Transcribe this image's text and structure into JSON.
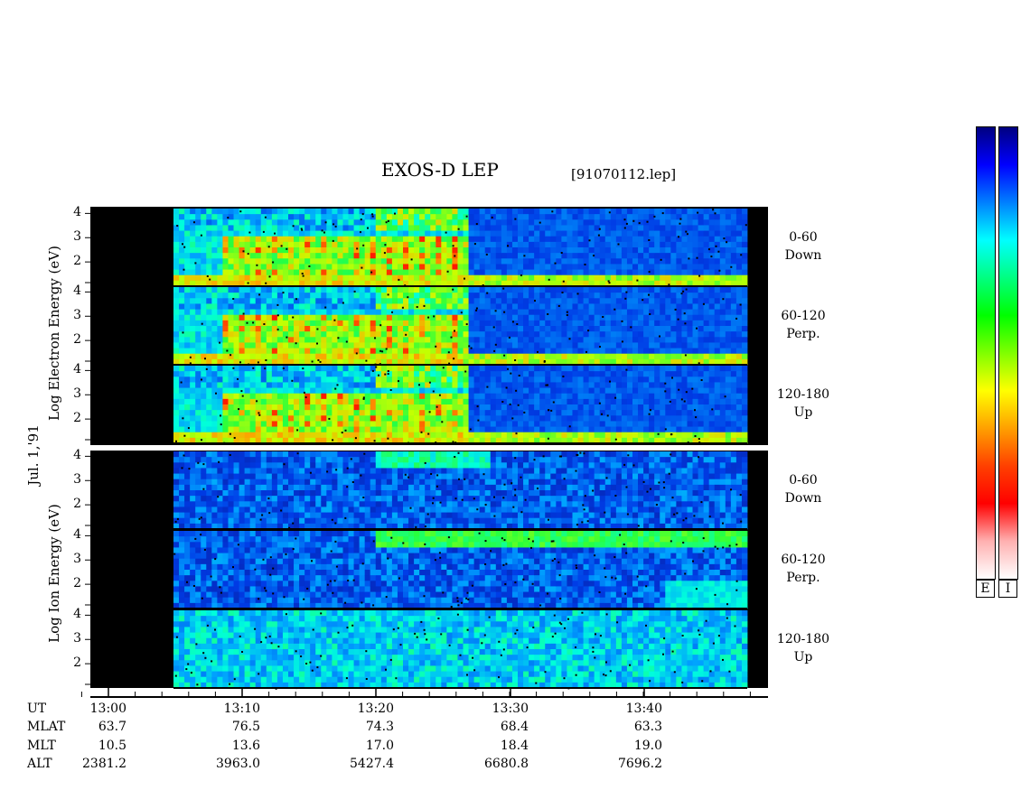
{
  "title": "EXOS-D LEP",
  "file_name": "[91070112.lep]",
  "date_label": "Jul. 1,'91",
  "electron_axis_label": "Log  Electron  Energy (eV)",
  "ion_axis_label": "Log  Ion  Energy (eV)",
  "colors": {
    "background": "#000000",
    "plot_base": "#0a2a9a",
    "separator": "#ffffff"
  },
  "chart_data": {
    "type": "heatmap",
    "title": "EXOS-D LEP",
    "x_axis": {
      "label": "UT",
      "ticks": [
        "13:00",
        "13:10",
        "13:20",
        "13:30",
        "13:40"
      ]
    },
    "panels": [
      {
        "species": "Electron",
        "angle_range": "0-60",
        "direction": "Down",
        "y_ticks": [
          "4",
          "3",
          "2"
        ],
        "ylim": [
          1,
          4.2
        ]
      },
      {
        "species": "Electron",
        "angle_range": "60-120",
        "direction": "Perp.",
        "y_ticks": [
          "4",
          "3",
          "2"
        ],
        "ylim": [
          1,
          4.2
        ]
      },
      {
        "species": "Electron",
        "angle_range": "120-180",
        "direction": "Up",
        "y_ticks": [
          "4",
          "3",
          "2"
        ],
        "ylim": [
          1,
          4.2
        ]
      },
      {
        "species": "Ion",
        "angle_range": "0-60",
        "direction": "Down",
        "y_ticks": [
          "4",
          "3",
          "2"
        ],
        "ylim": [
          1,
          4.2
        ]
      },
      {
        "species": "Ion",
        "angle_range": "60-120",
        "direction": "Perp.",
        "y_ticks": [
          "4",
          "3",
          "2"
        ],
        "ylim": [
          1,
          4.2
        ]
      },
      {
        "species": "Ion",
        "angle_range": "120-180",
        "direction": "Up",
        "y_ticks": [
          "4",
          "3",
          "2"
        ],
        "ylim": [
          1,
          4.2
        ]
      }
    ],
    "orbit_table": {
      "rows": [
        "UT",
        "MLAT",
        "MLT",
        "ALT"
      ],
      "columns": [
        {
          "UT": "13:00",
          "MLAT": "63.7",
          "MLT": "10.5",
          "ALT": "2381.2"
        },
        {
          "UT": "13:10",
          "MLAT": "76.5",
          "MLT": "13.6",
          "ALT": "3963.0"
        },
        {
          "UT": "13:20",
          "MLAT": "74.3",
          "MLT": "17.0",
          "ALT": "5427.4"
        },
        {
          "UT": "13:30",
          "MLAT": "68.4",
          "MLT": "18.4",
          "ALT": "6680.8"
        },
        {
          "UT": "13:40",
          "MLAT": "63.3",
          "MLT": "19.0",
          "ALT": "7696.2"
        }
      ]
    },
    "color_scale": {
      "labels": [
        "E",
        "I"
      ],
      "colors_top_to_bottom": [
        "#000080",
        "#0000ff",
        "#0080ff",
        "#00ffff",
        "#00ff80",
        "#00ff00",
        "#80ff00",
        "#ffff00",
        "#ffa000",
        "#ff4000",
        "#ff0000",
        "#ffb0b0",
        "#ffffff"
      ]
    }
  }
}
